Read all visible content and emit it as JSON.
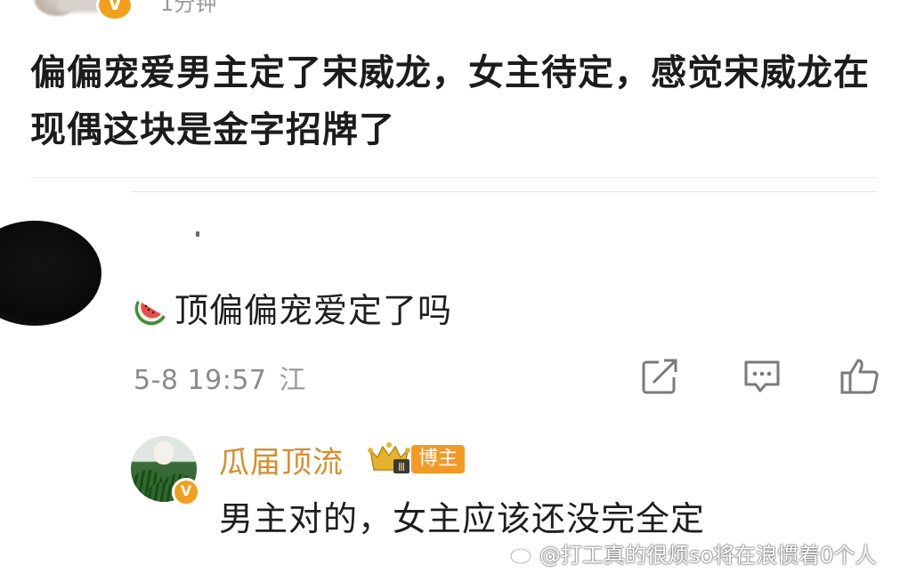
{
  "header": {
    "verified_badge": "V",
    "time_text": "1分钟"
  },
  "post": {
    "text": "偏偏宠爱男主定了宋威龙，女主待定，感觉宋威龙在现偶这块是金字招牌了"
  },
  "comment": {
    "emoji": "watermelon-icon",
    "text": "顶偏偏宠爱定了吗",
    "time": "5-8 19:57",
    "location": "江 ",
    "actions": [
      "share-icon",
      "reply-icon",
      "like-icon"
    ]
  },
  "reply": {
    "user_name": "瓜届顶流",
    "badge": "博主",
    "verified_badge": "V",
    "text": "男主对的，女主应该还没完全定"
  },
  "watermark": {
    "text": "@打工真的很烦so将在浪惯着0个人"
  },
  "colors": {
    "username_orange": "#d88d2c",
    "badge_orange": "#f49a22",
    "verified_orange": "#f2a01c",
    "meta_gray": "#8a8a8a"
  }
}
